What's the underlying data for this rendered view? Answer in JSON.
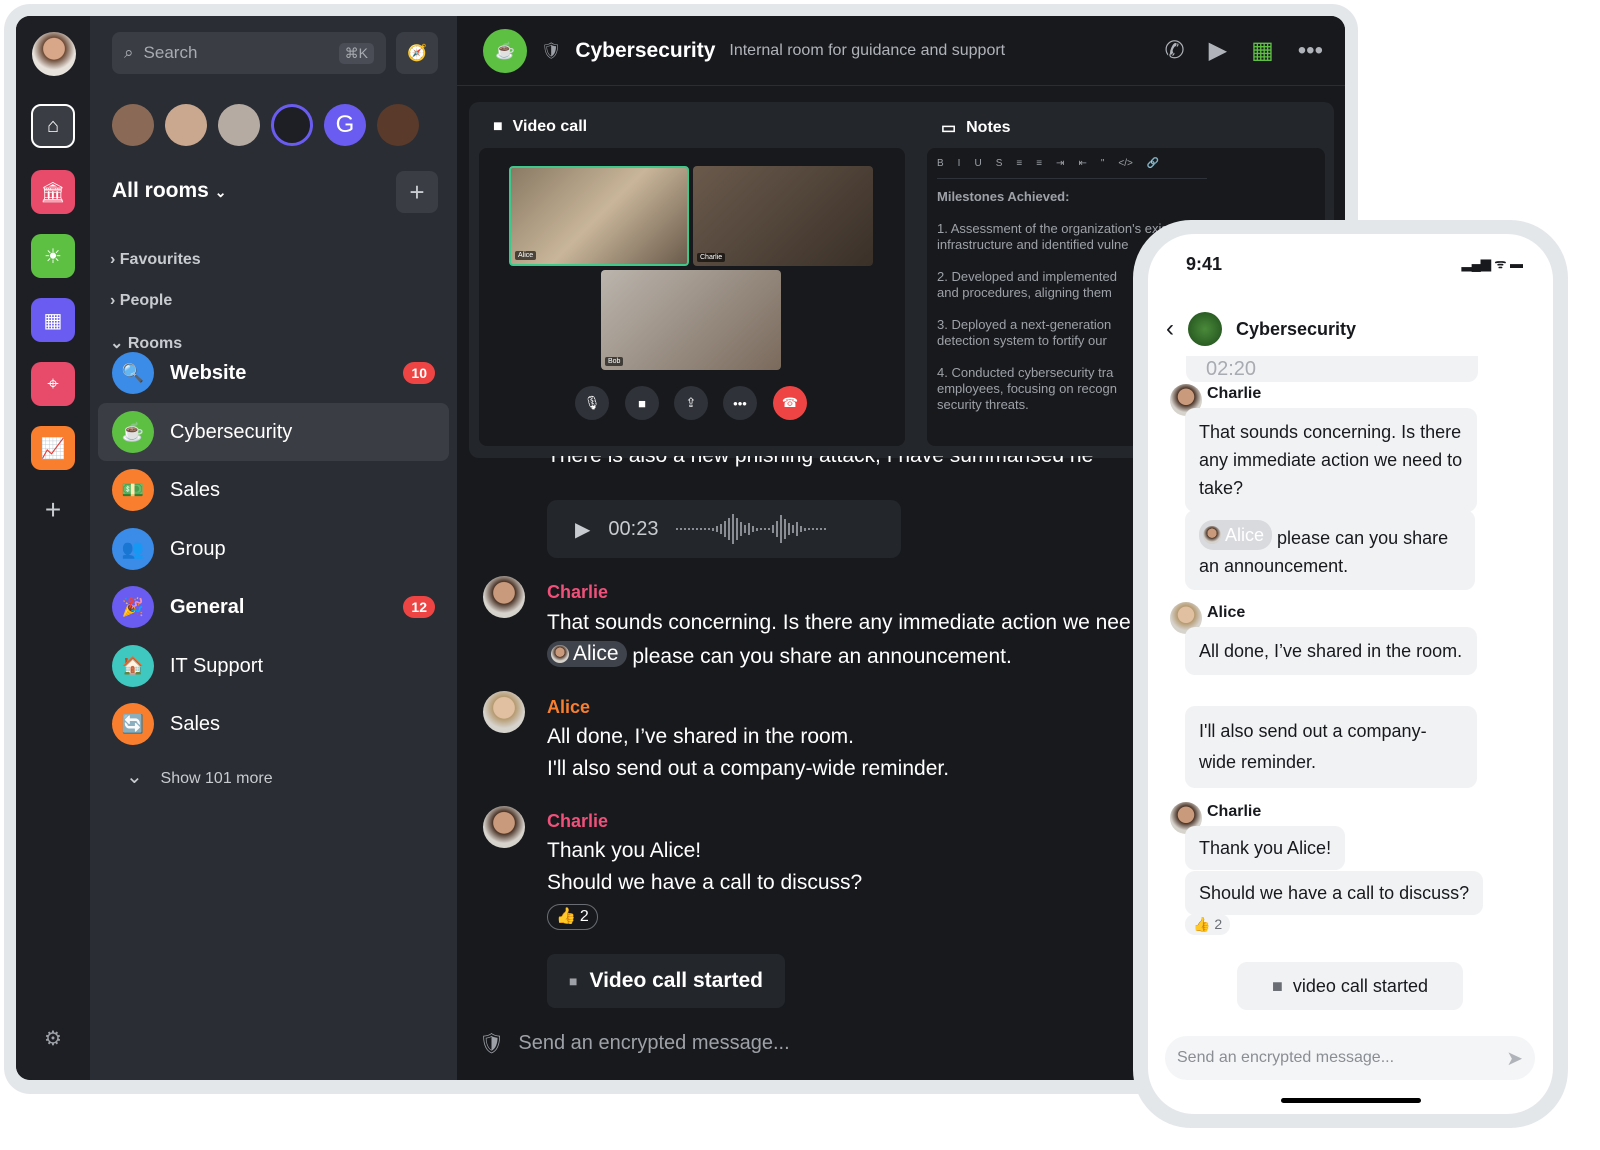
{
  "search": {
    "placeholder": "Search",
    "shortcut": "⌘K"
  },
  "sidebar": {
    "all_rooms": "All rooms",
    "sections": [
      "Favourites",
      "People",
      "Rooms"
    ],
    "rooms": [
      {
        "name": "Website",
        "badge": "10",
        "color": "#3b8be8",
        "bold": true
      },
      {
        "name": "Cybersecurity",
        "color": "#5ec043",
        "active": true
      },
      {
        "name": "Sales",
        "color": "#f97f2f"
      },
      {
        "name": "Group",
        "color": "#3b8be8"
      },
      {
        "name": "General",
        "badge": "12",
        "color": "#6a5cf0",
        "bold": true
      },
      {
        "name": "IT Support",
        "color": "#3ec8c0"
      },
      {
        "name": "Sales",
        "color": "#f97f2f"
      }
    ],
    "show_more": "Show 101 more"
  },
  "header": {
    "title": "Cybersecurity",
    "topic": "Internal room for guidance and support"
  },
  "video": {
    "title": "Video call",
    "participants": [
      "Alice",
      "Charlie",
      "Bob"
    ]
  },
  "notes": {
    "title": "Notes",
    "toolbar": [
      "B",
      "I",
      "U",
      "S",
      "≡",
      "≡",
      "⇥",
      "⇤",
      "\"",
      "</>",
      "🔗"
    ],
    "heading": "Milestones Achieved:",
    "items": [
      "1. Assessment of the organization's existing security infrastructure and identified vulne",
      "2. Developed and implemented and procedures, aligning them",
      "3. Deployed a next-generation detection system to fortify our",
      "4. Conducted cybersecurity tra employees, focusing on recogn security threats."
    ]
  },
  "messages": {
    "partial": "There is also a new phishing attack, I have summarised he",
    "audio_time": "00:23",
    "list": [
      {
        "sender": "Charlie",
        "color": "#f0507a",
        "lines": [
          "That sounds concerning. Is there any immediate action we nee"
        ],
        "mention": "Alice",
        "mention_text": "please can you share an announcement."
      },
      {
        "sender": "Alice",
        "color": "#f97f2f",
        "lines": [
          "All done, I’ve shared in the room.",
          "I'll also send out a company-wide reminder."
        ]
      },
      {
        "sender": "Charlie",
        "color": "#f0507a",
        "lines": [
          "Thank you Alice!",
          "Should we have a call to discuss?"
        ],
        "reaction": "👍",
        "reaction_count": "2"
      }
    ],
    "call_started": "Video call started",
    "composer_placeholder": "Send an encrypted message..."
  },
  "phone": {
    "time": "9:41",
    "title": "Cybersecurity",
    "audio_partial": "02:20",
    "msgs": [
      {
        "sender": "Charlie",
        "bubbles": [
          "That sounds concerning. Is there any immediate action we need to take?"
        ],
        "mention": "Alice",
        "mention_text": "please can you share an announcement."
      },
      {
        "sender": "Alice",
        "bubbles": [
          "All done, I’ve shared in the room.",
          "I'll also send out a company-wide reminder."
        ]
      },
      {
        "sender": "Charlie",
        "bubbles": [
          "Thank you Alice!",
          "Should we have a call to discuss?"
        ],
        "reaction": "👍",
        "reaction_count": "2"
      }
    ],
    "call_started": "video call started",
    "composer_placeholder": "Send an encrypted message..."
  }
}
